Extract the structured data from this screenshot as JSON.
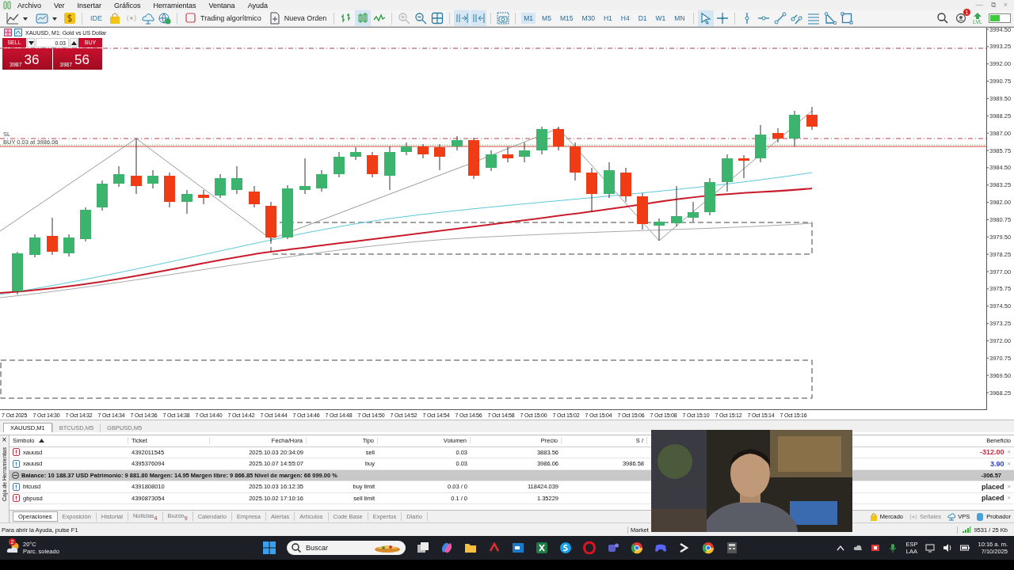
{
  "window": {
    "controls": [
      "—",
      "⧉",
      "×"
    ]
  },
  "menu": [
    "Archivo",
    "Ver",
    "Insertar",
    "Gráficos",
    "Herramientas",
    "Ventana",
    "Ayuda"
  ],
  "toolbar": {
    "ide": "IDE",
    "algo": "Trading algorítmico",
    "new_order": "Nueva Orden",
    "lvl": "LVL",
    "notifications": "1",
    "timeframes": [
      {
        "label": "M1",
        "selected": true
      },
      {
        "label": "M5",
        "selected": false
      },
      {
        "label": "M15",
        "selected": false
      },
      {
        "label": "M30",
        "selected": false
      },
      {
        "label": "H1",
        "selected": false
      },
      {
        "label": "H4",
        "selected": false
      },
      {
        "label": "D1",
        "selected": false
      },
      {
        "label": "W1",
        "selected": false
      },
      {
        "label": "MN",
        "selected": false
      }
    ]
  },
  "chart": {
    "title": "XAUUSD, M1:  Gold vs US Dollar",
    "trade_panel": {
      "sell": "SELL",
      "buy": "BUY",
      "volume": "0.03",
      "bid_small": "3987",
      "bid_big": "36",
      "ask_small": "3987",
      "ask_big": "56"
    },
    "sl_label": "SL",
    "order_label": "BUY 0.03 at 3986.06",
    "price_axis": [
      "3994.50",
      "3993.25",
      "3992.00",
      "3990.75",
      "3989.50",
      "3988.25",
      "3987.00",
      "3985.75",
      "3984.50",
      "3983.25",
      "3982.00",
      "3980.75",
      "3979.50",
      "3978.25",
      "3977.00",
      "3975.75",
      "3974.50",
      "3973.25",
      "3972.00",
      "3970.75",
      "3969.50",
      "3968.25"
    ],
    "time_axis": [
      "7 Oct 2025",
      "7 Oct 14:30",
      "7 Oct 14:32",
      "7 Oct 14:34",
      "7 Oct 14:36",
      "7 Oct 14:38",
      "7 Oct 14:40",
      "7 Oct 14:42",
      "7 Oct 14:44",
      "7 Oct 14:46",
      "7 Oct 14:48",
      "7 Oct 14:50",
      "7 Oct 14:52",
      "7 Oct 14:54",
      "7 Oct 14:56",
      "7 Oct 14:58",
      "7 Oct 15:00",
      "7 Oct 15:02",
      "7 Oct 15:04",
      "7 Oct 15:06",
      "7 Oct 15:08",
      "7 Oct 15:10",
      "7 Oct 15:12",
      "7 Oct 15:14",
      "7 Oct 15:16"
    ]
  },
  "chart_tabs": [
    {
      "label": "XAUUSD,M1",
      "selected": true
    },
    {
      "label": "BTCUSD,M5",
      "selected": false
    },
    {
      "label": "GBPUSD,M5",
      "selected": false
    }
  ],
  "toolbox": {
    "side_label": "Caja de Herramientas",
    "close": "×",
    "columns": [
      "Símbolo",
      "Ticket",
      "Fecha/Hora",
      "Tipo",
      "Volumen",
      "Precio",
      "S /",
      "Beneficio"
    ],
    "rows": [
      {
        "kind": "sell",
        "symbol": "xauusd",
        "ticket": "4392011545",
        "time": "2025.10.03 20:34:09",
        "type": "sell",
        "volume": "0.03",
        "price": "3883.56",
        "profit": "-312.00",
        "color": "#d0243c"
      },
      {
        "kind": "buy",
        "symbol": "xauusd",
        "ticket": "4395376094",
        "time": "2025.10.07 14:55:07",
        "type": "buy",
        "volume": "0.03",
        "price": "3986.06",
        "sl": "3986.58",
        "profit": "3.90",
        "color": "#2a3cd0"
      },
      {
        "kind": "balance",
        "text": "Balance: 10 188.37 USD  Patrimonio: 9 881.80  Margen: 14.95  Margen libre: 9 866.85  Nivel de margen: 66 099.00 %",
        "profit": "-306.57"
      },
      {
        "kind": "buy",
        "symbol": "btcusd",
        "ticket": "4391808010",
        "time": "2025.10.03 16:12:35",
        "type": "buy limit",
        "volume": "0.03 / 0",
        "price": "118424.039",
        "profit": "placed",
        "color": "#222222"
      },
      {
        "kind": "sell",
        "symbol": "gbpusd",
        "ticket": "4390873054",
        "time": "2025.10.02 17:10:16",
        "type": "sell limit",
        "volume": "0.1 / 0",
        "price": "1.35229",
        "profit": "placed",
        "color": "#222222"
      }
    ],
    "tabs": [
      {
        "label": "Operaciones",
        "selected": true
      },
      {
        "label": "Exposición",
        "selected": false
      },
      {
        "label": "Historial",
        "selected": false
      },
      {
        "label": "Noticias",
        "badge": "4",
        "selected": false
      },
      {
        "label": "Buzón",
        "badge": "9",
        "selected": false
      },
      {
        "label": "Calendario",
        "selected": false
      },
      {
        "label": "Empresa",
        "selected": false
      },
      {
        "label": "Alertas",
        "selected": false
      },
      {
        "label": "Artículos",
        "selected": false
      },
      {
        "label": "Code Base",
        "selected": false
      },
      {
        "label": "Expertos",
        "selected": false
      },
      {
        "label": "Diario",
        "selected": false
      }
    ],
    "right_tabs": [
      {
        "kind": "market",
        "label": "Mercado",
        "disabled": false
      },
      {
        "kind": "signals",
        "label": "Señales",
        "disabled": true
      },
      {
        "kind": "vps",
        "label": "VPS",
        "disabled": false
      },
      {
        "kind": "tester",
        "label": "Probador",
        "disabled": false
      }
    ]
  },
  "status_bar": {
    "help": "Para abrir la Ayuda, pulse F1",
    "market": "Market",
    "traffic": "9531 / 25 Kb"
  },
  "webcam": {
    "kind": "picture"
  },
  "taskbar": {
    "weather_badge": "2",
    "temperature": "20°C",
    "weather": "Parc. soleado",
    "search": "Buscar",
    "language": "ESP",
    "layout": "LAA",
    "time": "10:16 a. m.",
    "date": "7/10/2025"
  }
}
